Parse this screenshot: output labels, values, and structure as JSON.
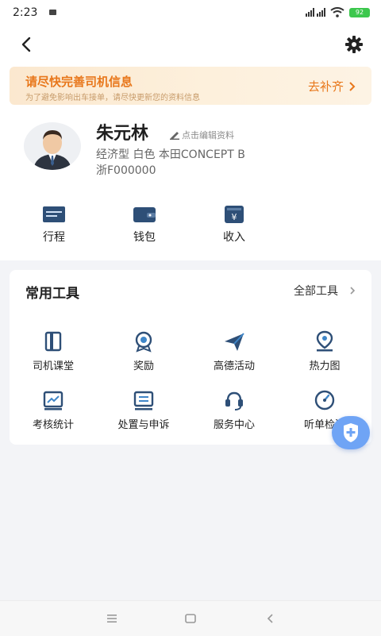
{
  "status": {
    "time": "2:23",
    "battery": "92"
  },
  "banner": {
    "title": "请尽快完善司机信息",
    "subtitle": "为了避免影响出车接单，请尽快更新您的资料信息",
    "action": "去补齐"
  },
  "profile": {
    "name": "朱元林",
    "edit_label": "点击编辑资料",
    "car_info": "经济型 白色 本田CONCEPT B",
    "plate": "浙F000000"
  },
  "quick_actions": [
    {
      "label": "行程",
      "icon": "itinerary-icon"
    },
    {
      "label": "钱包",
      "icon": "wallet-icon"
    },
    {
      "label": "收入",
      "icon": "income-icon"
    }
  ],
  "tools": {
    "title": "常用工具",
    "all_label": "全部工具",
    "items": [
      {
        "label": "司机课堂",
        "icon": "book-icon"
      },
      {
        "label": "奖励",
        "icon": "medal-icon"
      },
      {
        "label": "高德活动",
        "icon": "paper-plane-icon"
      },
      {
        "label": "热力图",
        "icon": "map-pin-icon"
      },
      {
        "label": "考核统计",
        "icon": "chart-icon"
      },
      {
        "label": "处置与申诉",
        "icon": "message-icon"
      },
      {
        "label": "服务中心",
        "icon": "headset-icon"
      },
      {
        "label": "听单检测",
        "icon": "gauge-icon"
      }
    ]
  },
  "colors": {
    "accent_orange": "#e8771b",
    "icon_blue": "#2e4f77",
    "fab_blue": "#6fa4f5"
  }
}
